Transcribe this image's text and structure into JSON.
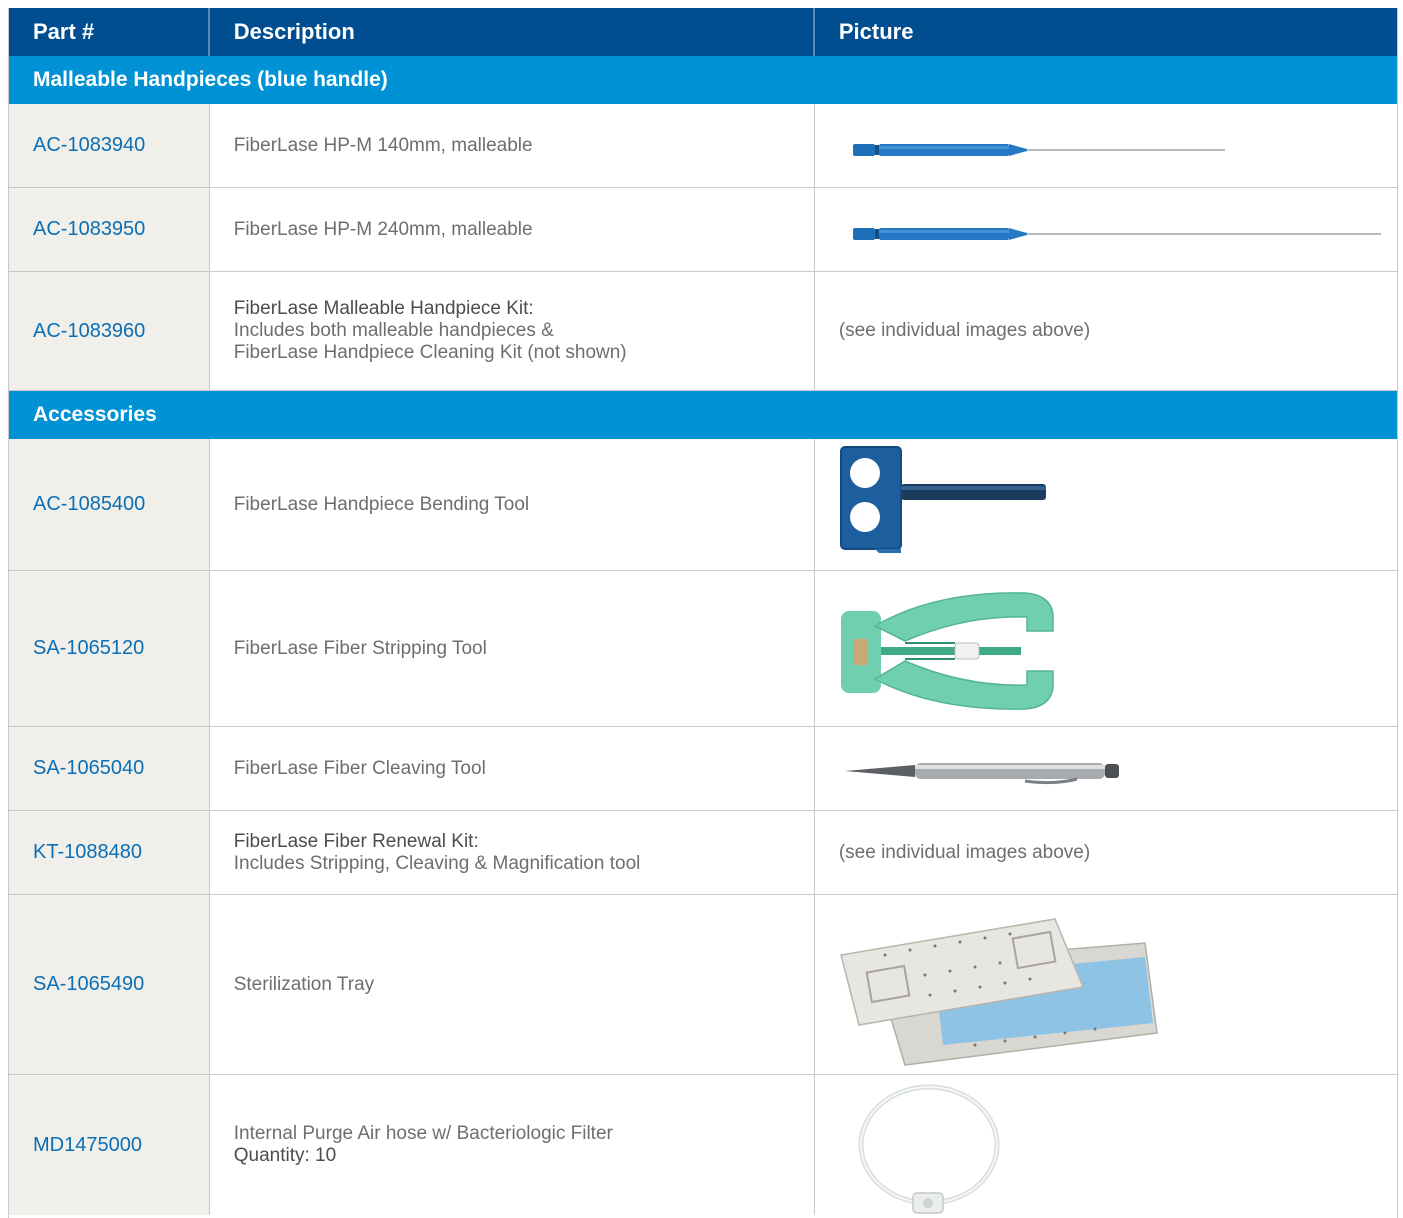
{
  "header": {
    "col_part": "Part #",
    "col_description": "Description",
    "col_picture": "Picture"
  },
  "sections": [
    {
      "title": "Malleable Handpieces (blue handle)",
      "rows": [
        {
          "part": "AC-1083940",
          "desc_lines": [
            "FiberLase HP-M 140mm, malleable"
          ],
          "picture": "handpiece-140-image"
        },
        {
          "part": "AC-1083950",
          "desc_lines": [
            "FiberLase HP-M 240mm, malleable"
          ],
          "picture": "handpiece-240-image"
        },
        {
          "part": "AC-1083960",
          "desc_title": "FiberLase Malleable Handpiece Kit:",
          "desc_lines": [
            "Includes both malleable handpieces &",
            "FiberLase Handpiece Cleaning Kit (not shown)"
          ],
          "picture_text": "(see individual images above)"
        }
      ]
    },
    {
      "title": "Accessories",
      "rows": [
        {
          "part": "AC-1085400",
          "desc_lines": [
            "FiberLase Handpiece Bending Tool"
          ],
          "picture": "bending-tool-image"
        },
        {
          "part": "SA-1065120",
          "desc_lines": [
            "FiberLase Fiber Stripping Tool"
          ],
          "picture": "stripping-tool-image"
        },
        {
          "part": "SA-1065040",
          "desc_lines": [
            "FiberLase Fiber Cleaving Tool"
          ],
          "picture": "cleaving-tool-image"
        },
        {
          "part": "KT-1088480",
          "desc_title": "FiberLase Fiber Renewal Kit:",
          "desc_lines": [
            "Includes Stripping, Cleaving & Magnification tool"
          ],
          "picture_text": "(see individual images above)"
        },
        {
          "part": "SA-1065490",
          "desc_lines": [
            "Sterilization Tray"
          ],
          "picture": "sterilization-tray-image"
        },
        {
          "part": "MD1475000",
          "desc_lines": [
            "Internal Purge Air hose w/ Bacteriologic Filter"
          ],
          "desc_qty": "Quantity: 10",
          "picture": "purge-air-hose-image"
        }
      ]
    }
  ],
  "colors": {
    "header_bg": "#004e8f",
    "section_bg": "#0092d4",
    "part_text": "#0a6fb5",
    "part_col_bg": "#f1efea",
    "handpiece_blue": "#1f6fb8",
    "stripper_green": "#6fcfae"
  }
}
